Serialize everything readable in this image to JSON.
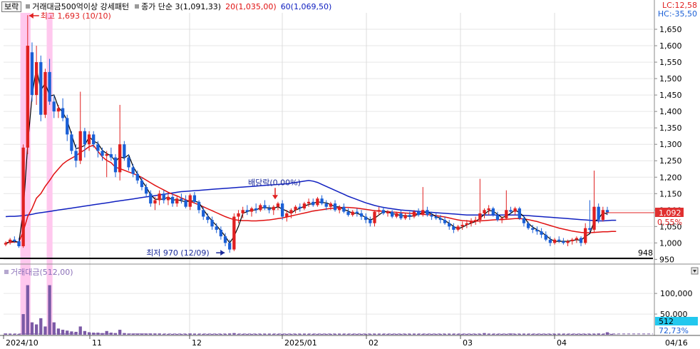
{
  "header": {
    "stock_name": "보락",
    "condition": "거래대금500억이상 강세패턴",
    "legend": [
      {
        "label": "종가 단순 3(1,091,33)",
        "color": "#000000"
      },
      {
        "label": "20(1,035,00)",
        "color": "#e01010"
      },
      {
        "label": "60(1,069,50)",
        "color": "#1020c0"
      }
    ],
    "lc_label": "LC:12,58",
    "hc_label": "HC:-35,50"
  },
  "annotations": {
    "high": "최고 1,693 (10/10)",
    "low": "최저 970 (12/09)",
    "ex_dividend": "배당락(0,00%)",
    "baseline": "948"
  },
  "price_axis": {
    "ticks": [
      "1,650",
      "1,600",
      "1,550",
      "1,500",
      "1,450",
      "1,400",
      "1,350",
      "1,300",
      "1,250",
      "1,200",
      "1,150",
      "1,100",
      "1,050",
      "1,000",
      "950"
    ],
    "current_price": "1,092",
    "current_change": "0,55%"
  },
  "volume": {
    "title": "거래대금(512,00)",
    "ticks": [
      "100,000",
      "50,000"
    ],
    "current_value": "512",
    "current_pct": "72,73%"
  },
  "date_axis": [
    "2024/10",
    "11",
    "12",
    "2025/01",
    "02",
    "03",
    "04",
    "04/16"
  ],
  "colors": {
    "up": "#e02020",
    "down": "#1a5fd6",
    "ma3": "#000000",
    "ma20": "#e01010",
    "ma60": "#1020c0",
    "highlight": "#ffc8ee",
    "current_box": "#e03030",
    "volume_box": "#22c8ee"
  },
  "chart_data": {
    "type": "candlestick",
    "ylim": [
      940,
      1700
    ],
    "volume_ylim": [
      0,
      140000
    ],
    "x": [
      "2024/10",
      "11",
      "12",
      "2025/01",
      "02",
      "03",
      "04",
      "04/16"
    ],
    "key_points": [
      {
        "date": "10/10",
        "label": "최고",
        "value": 1693
      },
      {
        "date": "12/09",
        "label": "최저",
        "value": 970
      }
    ],
    "candles": [
      [
        995,
        1005,
        990,
        1000
      ],
      [
        1000,
        1015,
        995,
        1010
      ],
      [
        1010,
        1020,
        1000,
        1005
      ],
      [
        1005,
        1015,
        985,
        990
      ],
      [
        990,
        1300,
        985,
        1290
      ],
      [
        1290,
        1693,
        1270,
        1600
      ],
      [
        1580,
        1610,
        1430,
        1450
      ],
      [
        1450,
        1600,
        1420,
        1550
      ],
      [
        1550,
        1570,
        1370,
        1390
      ],
      [
        1390,
        1530,
        1380,
        1520
      ],
      [
        1520,
        1560,
        1420,
        1430
      ],
      [
        1430,
        1450,
        1380,
        1400
      ],
      [
        1400,
        1420,
        1380,
        1410
      ],
      [
        1410,
        1440,
        1370,
        1380
      ],
      [
        1380,
        1390,
        1310,
        1330
      ],
      [
        1330,
        1340,
        1270,
        1280
      ],
      [
        1280,
        1300,
        1230,
        1250
      ],
      [
        1250,
        1460,
        1240,
        1340
      ],
      [
        1340,
        1350,
        1260,
        1300
      ],
      [
        1300,
        1340,
        1280,
        1330
      ],
      [
        1330,
        1340,
        1290,
        1300
      ],
      [
        1300,
        1310,
        1260,
        1280
      ],
      [
        1280,
        1290,
        1250,
        1265
      ],
      [
        1265,
        1280,
        1200,
        1270
      ],
      [
        1270,
        1290,
        1250,
        1260
      ],
      [
        1260,
        1270,
        1200,
        1215
      ],
      [
        1215,
        1420,
        1190,
        1300
      ],
      [
        1300,
        1310,
        1250,
        1260
      ],
      [
        1260,
        1270,
        1220,
        1230
      ],
      [
        1230,
        1240,
        1200,
        1210
      ],
      [
        1210,
        1220,
        1180,
        1190
      ],
      [
        1190,
        1200,
        1160,
        1170
      ],
      [
        1170,
        1180,
        1140,
        1150
      ],
      [
        1150,
        1160,
        1110,
        1120
      ],
      [
        1120,
        1140,
        1100,
        1130
      ],
      [
        1130,
        1160,
        1115,
        1150
      ],
      [
        1150,
        1160,
        1120,
        1130
      ],
      [
        1130,
        1150,
        1115,
        1140
      ],
      [
        1140,
        1150,
        1110,
        1120
      ],
      [
        1120,
        1145,
        1110,
        1135
      ],
      [
        1135,
        1150,
        1120,
        1130
      ],
      [
        1130,
        1145,
        1105,
        1110
      ],
      [
        1110,
        1150,
        1100,
        1145
      ],
      [
        1145,
        1155,
        1120,
        1125
      ],
      [
        1125,
        1130,
        1090,
        1100
      ],
      [
        1100,
        1110,
        1070,
        1080
      ],
      [
        1080,
        1090,
        1060,
        1070
      ],
      [
        1070,
        1080,
        1040,
        1050
      ],
      [
        1050,
        1060,
        1030,
        1040
      ],
      [
        1040,
        1050,
        1010,
        1020
      ],
      [
        1020,
        1030,
        990,
        1000
      ],
      [
        1000,
        1010,
        970,
        980
      ],
      [
        980,
        1090,
        975,
        1080
      ],
      [
        1080,
        1100,
        1060,
        1090
      ],
      [
        1090,
        1110,
        1075,
        1100
      ],
      [
        1100,
        1115,
        1085,
        1095
      ],
      [
        1095,
        1110,
        1080,
        1105
      ],
      [
        1105,
        1120,
        1090,
        1100
      ],
      [
        1100,
        1120,
        1095,
        1115
      ],
      [
        1115,
        1130,
        1100,
        1105
      ],
      [
        1105,
        1115,
        1090,
        1100
      ],
      [
        1100,
        1115,
        1085,
        1110
      ],
      [
        1110,
        1125,
        1100,
        1120
      ],
      [
        1120,
        1130,
        1070,
        1080
      ],
      [
        1080,
        1100,
        1065,
        1090
      ],
      [
        1090,
        1105,
        1075,
        1100
      ],
      [
        1100,
        1115,
        1090,
        1110
      ],
      [
        1110,
        1120,
        1095,
        1105
      ],
      [
        1105,
        1125,
        1100,
        1120
      ],
      [
        1120,
        1135,
        1110,
        1125
      ],
      [
        1125,
        1135,
        1110,
        1115
      ],
      [
        1115,
        1140,
        1110,
        1135
      ],
      [
        1135,
        1145,
        1115,
        1120
      ],
      [
        1120,
        1130,
        1100,
        1110
      ],
      [
        1110,
        1125,
        1100,
        1120
      ],
      [
        1120,
        1130,
        1095,
        1100
      ],
      [
        1100,
        1115,
        1090,
        1110
      ],
      [
        1110,
        1120,
        1090,
        1095
      ],
      [
        1095,
        1105,
        1080,
        1085
      ],
      [
        1085,
        1100,
        1080,
        1095
      ],
      [
        1095,
        1105,
        1080,
        1090
      ],
      [
        1090,
        1100,
        1070,
        1080
      ],
      [
        1080,
        1090,
        1060,
        1070
      ],
      [
        1070,
        1080,
        1050,
        1060
      ],
      [
        1060,
        1100,
        1050,
        1095
      ],
      [
        1095,
        1110,
        1085,
        1100
      ],
      [
        1100,
        1110,
        1085,
        1090
      ],
      [
        1090,
        1100,
        1080,
        1095
      ],
      [
        1095,
        1100,
        1075,
        1080
      ],
      [
        1080,
        1095,
        1075,
        1090
      ],
      [
        1090,
        1100,
        1070,
        1075
      ],
      [
        1075,
        1090,
        1070,
        1085
      ],
      [
        1085,
        1095,
        1070,
        1080
      ],
      [
        1080,
        1100,
        1075,
        1095
      ],
      [
        1095,
        1105,
        1080,
        1085
      ],
      [
        1085,
        1170,
        1080,
        1100
      ],
      [
        1100,
        1110,
        1080,
        1085
      ],
      [
        1085,
        1095,
        1070,
        1080
      ],
      [
        1080,
        1090,
        1070,
        1075
      ],
      [
        1075,
        1085,
        1060,
        1070
      ],
      [
        1070,
        1080,
        1055,
        1060
      ],
      [
        1060,
        1070,
        1040,
        1050
      ],
      [
        1050,
        1060,
        1030,
        1040
      ],
      [
        1040,
        1055,
        1035,
        1050
      ],
      [
        1050,
        1065,
        1040,
        1055
      ],
      [
        1055,
        1070,
        1045,
        1060
      ],
      [
        1060,
        1075,
        1050,
        1065
      ],
      [
        1065,
        1080,
        1055,
        1070
      ],
      [
        1070,
        1195,
        1060,
        1090
      ],
      [
        1090,
        1105,
        1075,
        1100
      ],
      [
        1100,
        1115,
        1085,
        1105
      ],
      [
        1105,
        1110,
        1080,
        1085
      ],
      [
        1085,
        1095,
        1065,
        1070
      ],
      [
        1070,
        1080,
        1060,
        1075
      ],
      [
        1075,
        1160,
        1070,
        1100
      ],
      [
        1100,
        1110,
        1090,
        1095
      ],
      [
        1095,
        1110,
        1085,
        1105
      ],
      [
        1105,
        1110,
        1070,
        1075
      ],
      [
        1075,
        1085,
        1050,
        1060
      ],
      [
        1060,
        1065,
        1040,
        1045
      ],
      [
        1045,
        1055,
        1030,
        1040
      ],
      [
        1040,
        1050,
        1025,
        1035
      ],
      [
        1035,
        1045,
        1015,
        1025
      ],
      [
        1025,
        1035,
        1005,
        1010
      ],
      [
        1010,
        1020,
        990,
        1000
      ],
      [
        1000,
        1015,
        995,
        1010
      ],
      [
        1010,
        1020,
        1000,
        1005
      ],
      [
        1005,
        1015,
        995,
        1000
      ],
      [
        1000,
        1010,
        990,
        1005
      ],
      [
        1005,
        1015,
        995,
        1010
      ],
      [
        1010,
        1020,
        1000,
        1015
      ],
      [
        1015,
        1020,
        990,
        1000
      ],
      [
        1000,
        1060,
        995,
        1045
      ],
      [
        1045,
        1130,
        1030,
        1040
      ],
      [
        1040,
        1220,
        1030,
        1110
      ],
      [
        1110,
        1120,
        1060,
        1070
      ],
      [
        1070,
        1110,
        1065,
        1100
      ],
      [
        1100,
        1110,
        1085,
        1092
      ]
    ],
    "ma3": [
      997,
      1005,
      1005,
      1002,
      1095,
      1297,
      1447,
      1533,
      1463,
      1487,
      1447,
      1450,
      1413,
      1397,
      1373,
      1330,
      1287,
      1290,
      1297,
      1323,
      1310,
      1303,
      1282,
      1272,
      1265,
      1248,
      1262,
      1258,
      1268,
      1233,
      1210,
      1190,
      1170,
      1147,
      1133,
      1133,
      1133,
      1140,
      1130,
      1132,
      1128,
      1125,
      1128,
      1127,
      1123,
      1102,
      1083,
      1067,
      1053,
      1037,
      1020,
      1000,
      1020,
      1050,
      1090,
      1095,
      1100,
      1100,
      1107,
      1107,
      1107,
      1105,
      1110,
      1103,
      1097,
      1090,
      1100,
      1105,
      1112,
      1117,
      1120,
      1125,
      1123,
      1122,
      1117,
      1110,
      1110,
      1102,
      1097,
      1090,
      1090,
      1085,
      1077,
      1070,
      1075,
      1085,
      1095,
      1095,
      1088,
      1088,
      1082,
      1083,
      1080,
      1083,
      1087,
      1093,
      1093,
      1088,
      1080,
      1075,
      1068,
      1060,
      1050,
      1043,
      1048,
      1055,
      1060,
      1065,
      1075,
      1087,
      1098,
      1097,
      1087,
      1077,
      1082,
      1090,
      1100,
      1092,
      1080,
      1060,
      1048,
      1040,
      1033,
      1023,
      1012,
      1005,
      1005,
      1005,
      1005,
      1007,
      1010,
      1008,
      1020,
      1028,
      1065,
      1073,
      1093,
      1087
    ],
    "ma20": [
      1000,
      1002,
      1003,
      1003,
      1035,
      1080,
      1105,
      1136,
      1150,
      1172,
      1190,
      1210,
      1225,
      1240,
      1250,
      1258,
      1265,
      1275,
      1283,
      1293,
      1297,
      1279,
      1262,
      1251,
      1244,
      1230,
      1226,
      1221,
      1216,
      1211,
      1206,
      1199,
      1191,
      1183,
      1175,
      1168,
      1161,
      1154,
      1148,
      1143,
      1137,
      1131,
      1126,
      1121,
      1116,
      1110,
      1104,
      1098,
      1092,
      1086,
      1080,
      1075,
      1071,
      1069,
      1068,
      1068,
      1067,
      1067,
      1068,
      1069,
      1070,
      1072,
      1074,
      1076,
      1079,
      1082,
      1085,
      1088,
      1091,
      1094,
      1097,
      1099,
      1101,
      1103,
      1105,
      1106,
      1107,
      1108,
      1108,
      1107,
      1106,
      1104,
      1102,
      1100,
      1098,
      1097,
      1096,
      1095,
      1094,
      1093,
      1092,
      1091,
      1090,
      1089,
      1088,
      1087,
      1086,
      1085,
      1083,
      1081,
      1079,
      1076,
      1073,
      1070,
      1068,
      1067,
      1066,
      1066,
      1067,
      1068,
      1069,
      1070,
      1071,
      1071,
      1072,
      1073,
      1074,
      1074,
      1073,
      1071,
      1068,
      1065,
      1061,
      1057,
      1053,
      1049,
      1045,
      1042,
      1039,
      1036,
      1034,
      1032,
      1031,
      1031,
      1032,
      1033,
      1034,
      1034,
      1035,
      1035
    ],
    "ma60": [
      1080,
      1081,
      1081,
      1082,
      1083,
      1085,
      1087,
      1090,
      1092,
      1094,
      1096,
      1098,
      1100,
      1102,
      1104,
      1106,
      1108,
      1110,
      1112,
      1114,
      1116,
      1118,
      1120,
      1122,
      1124,
      1126,
      1128,
      1130,
      1132,
      1134,
      1136,
      1138,
      1140,
      1142,
      1144,
      1146,
      1148,
      1150,
      1152,
      1154,
      1156,
      1157,
      1158,
      1159,
      1160,
      1161,
      1162,
      1163,
      1164,
      1165,
      1166,
      1167,
      1168,
      1169,
      1170,
      1171,
      1172,
      1173,
      1174,
      1175,
      1176,
      1177,
      1178,
      1179,
      1180,
      1182,
      1184,
      1186,
      1188,
      1190,
      1188,
      1184,
      1178,
      1172,
      1166,
      1160,
      1154,
      1148,
      1142,
      1137,
      1132,
      1127,
      1122,
      1118,
      1114,
      1111,
      1108,
      1106,
      1104,
      1102,
      1100,
      1099,
      1098,
      1097,
      1096,
      1095,
      1094,
      1093,
      1092,
      1091,
      1090,
      1089,
      1088,
      1087,
      1086,
      1085,
      1085,
      1085,
      1085,
      1085,
      1085,
      1085,
      1085,
      1085,
      1085,
      1085,
      1085,
      1085,
      1084,
      1083,
      1082,
      1081,
      1080,
      1079,
      1078,
      1077,
      1076,
      1075,
      1074,
      1073,
      1072,
      1071,
      1070,
      1069,
      1068,
      1067,
      1067,
      1068,
      1069,
      1069
    ],
    "volume": [
      3000,
      2000,
      2000,
      2000,
      50000,
      120000,
      30000,
      25000,
      40000,
      20000,
      120000,
      30000,
      15000,
      12000,
      10000,
      8000,
      7000,
      20000,
      9000,
      6000,
      5000,
      5000,
      4000,
      9000,
      5000,
      4000,
      12000,
      4000,
      3000,
      3000,
      3000,
      3000,
      3000,
      3000,
      3000,
      3000,
      2000,
      2000,
      2000,
      2000,
      2000,
      2000,
      3000,
      2000,
      2000,
      2000,
      2000,
      2000,
      2000,
      2000,
      2000,
      3000,
      4000,
      2000,
      2000,
      2000,
      2000,
      2000,
      2000,
      2000,
      2000,
      2000,
      2000,
      2000,
      2000,
      2000,
      2000,
      2000,
      2000,
      2000,
      2000,
      2000,
      2000,
      2000,
      2000,
      2000,
      2000,
      2000,
      2000,
      2000,
      2000,
      2000,
      2000,
      2000,
      2000,
      2000,
      2000,
      2000,
      2000,
      2000,
      2000,
      2000,
      2000,
      2000,
      2000,
      2000,
      2000,
      2000,
      2000,
      2000,
      2000,
      2000,
      2000,
      2000,
      2000,
      2000,
      2000,
      2000,
      2000,
      4000,
      2000,
      2000,
      2000,
      2000,
      2000,
      3000,
      2000,
      2000,
      2000,
      2000,
      2000,
      2000,
      2000,
      2000,
      2000,
      2000,
      2000,
      2000,
      2000,
      2000,
      2000,
      2000,
      2000,
      2000,
      2000,
      3000,
      2000,
      6000,
      2000,
      512
    ]
  }
}
